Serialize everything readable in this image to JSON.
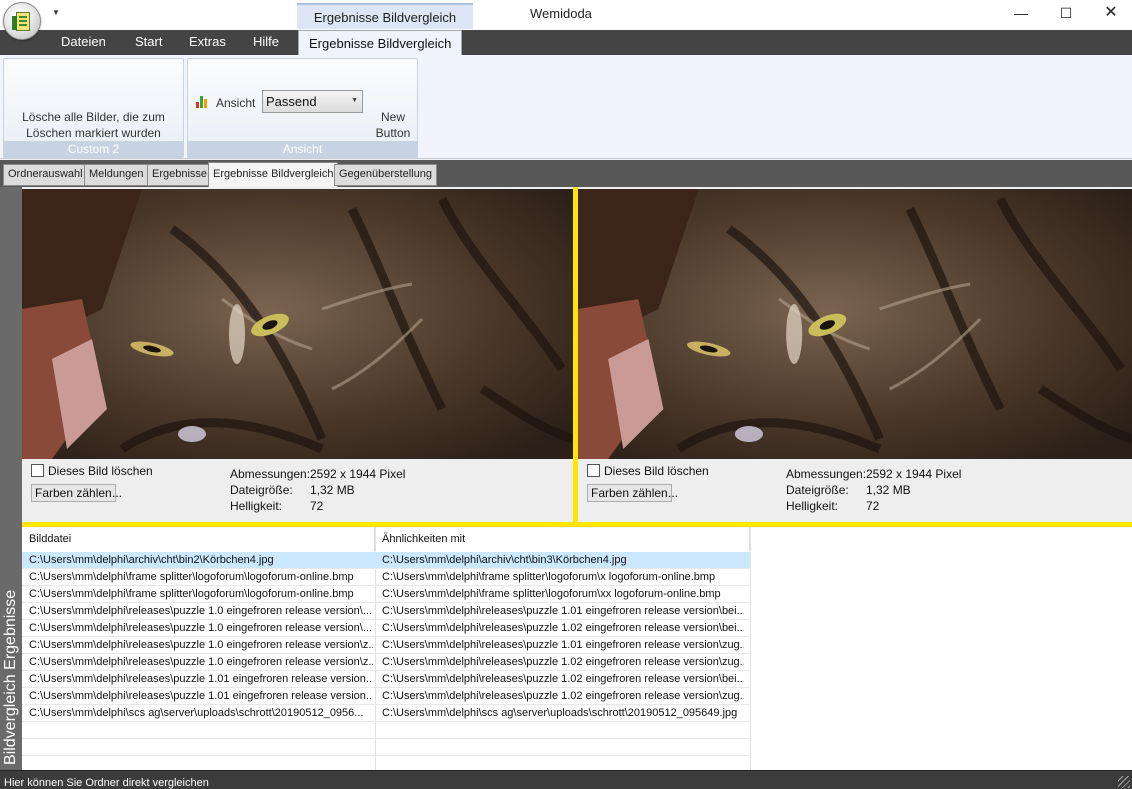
{
  "window": {
    "title": "Wemidoda",
    "context_tab_header": "Ergebnisse Bildvergleich",
    "minimize_glyph": "—",
    "maximize_glyph": "☐",
    "close_glyph": "✕"
  },
  "ribbon_tabs": [
    "Dateien",
    "Start",
    "Extras",
    "Hilfe",
    "Ergebnisse Bildvergleich"
  ],
  "ribbon": {
    "custom_group": {
      "button_line1": "Lösche alle Bilder, die zum",
      "button_line2": "Löschen markiert wurden",
      "caption": "Custom 2"
    },
    "ansicht_group": {
      "label": "Ansicht",
      "select_value": "Passend",
      "new_button_line1": "New",
      "new_button_line2": "Button",
      "caption": "Ansicht"
    }
  },
  "page_tabs": [
    "Ordnerauswahl",
    "Meldungen",
    "Ergebnisse",
    "Ergebnisse Bildvergleich",
    "Gegenüberstellung"
  ],
  "side_label": "Bildvergleich Ergebnisse",
  "left_image": {
    "delete_label": "Dieses Bild löschen",
    "count_button": "Farben zählen",
    "count_result": "...",
    "info": [
      {
        "key": "Abmessungen:",
        "value": "2592 x 1944 Pixel"
      },
      {
        "key": "Dateigröße:",
        "value": "1,32 MB"
      },
      {
        "key": "Helligkeit:",
        "value": "72"
      }
    ]
  },
  "right_image": {
    "delete_label": "Dieses Bild löschen",
    "count_button": "Farben zählen",
    "count_result": "...",
    "info": [
      {
        "key": "Abmessungen:",
        "value": "2592 x 1944 Pixel"
      },
      {
        "key": "Dateigröße:",
        "value": "1,32 MB"
      },
      {
        "key": "Helligkeit:",
        "value": "72"
      }
    ]
  },
  "grid": {
    "headers": [
      "Bilddatei",
      "Ähnlichkeiten mit"
    ],
    "rows": [
      [
        "C:\\Users\\mm\\delphi\\archiv\\cht\\bin2\\Körbchen4.jpg",
        "C:\\Users\\mm\\delphi\\archiv\\cht\\bin3\\Körbchen4.jpg"
      ],
      [
        "C:\\Users\\mm\\delphi\\frame splitter\\logoforum\\logoforum-online.bmp",
        "C:\\Users\\mm\\delphi\\frame splitter\\logoforum\\x logoforum-online.bmp"
      ],
      [
        "C:\\Users\\mm\\delphi\\frame splitter\\logoforum\\logoforum-online.bmp",
        "C:\\Users\\mm\\delphi\\frame splitter\\logoforum\\xx logoforum-online.bmp"
      ],
      [
        "C:\\Users\\mm\\delphi\\releases\\puzzle 1.0 eingefroren release version\\...",
        "C:\\Users\\mm\\delphi\\releases\\puzzle 1.01 eingefroren release version\\bei..."
      ],
      [
        "C:\\Users\\mm\\delphi\\releases\\puzzle 1.0 eingefroren release version\\...",
        "C:\\Users\\mm\\delphi\\releases\\puzzle 1.02 eingefroren release version\\bei..."
      ],
      [
        "C:\\Users\\mm\\delphi\\releases\\puzzle 1.0 eingefroren release version\\z...",
        "C:\\Users\\mm\\delphi\\releases\\puzzle 1.01 eingefroren release version\\zug..."
      ],
      [
        "C:\\Users\\mm\\delphi\\releases\\puzzle 1.0 eingefroren release version\\z...",
        "C:\\Users\\mm\\delphi\\releases\\puzzle 1.02 eingefroren release version\\zug..."
      ],
      [
        "C:\\Users\\mm\\delphi\\releases\\puzzle 1.01 eingefroren release version...",
        "C:\\Users\\mm\\delphi\\releases\\puzzle 1.02 eingefroren release version\\bei..."
      ],
      [
        "C:\\Users\\mm\\delphi\\releases\\puzzle 1.01 eingefroren release version...",
        "C:\\Users\\mm\\delphi\\releases\\puzzle 1.02 eingefroren release version\\zug..."
      ],
      [
        "C:\\Users\\mm\\delphi\\scs ag\\server\\uploads\\schrott\\20190512_0956...",
        "C:\\Users\\mm\\delphi\\scs ag\\server\\uploads\\schrott\\20190512_095649.jpg"
      ]
    ]
  },
  "status": "Hier können Sie Ordner direkt vergleichen",
  "colors": {
    "highlight_yellow": "#ffe600",
    "selected_row": "#cce8ff",
    "tab_strip": "#444444"
  }
}
